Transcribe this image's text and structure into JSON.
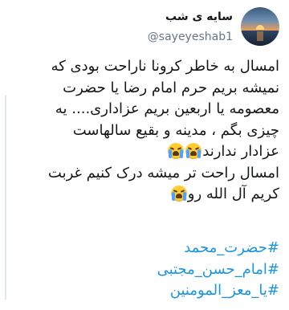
{
  "user": {
    "display_name": "سایه ی شب",
    "handle": "@sayeyeshab1"
  },
  "tweet": {
    "lines": [
      "امسال به خاطر کرونا ناراحت بودی که",
      "نمیشه بریم حرم امام رضا یا حضرت",
      "معصومه یا اربعین بریم عزاداری.... یه",
      "چیزی بگم ، مدینه و بقیع سالهاست",
      "عزادار ندارند",
      "امسال راحت تر میشه درک کنیم غربت",
      "کریم آل الله رو"
    ],
    "emoji_name": "loudly-crying-face-emoji"
  },
  "hashtags": [
    "#حضرت_محمد",
    "#امام_حسن_مجتبی",
    "#یا_معز_المومنین"
  ]
}
